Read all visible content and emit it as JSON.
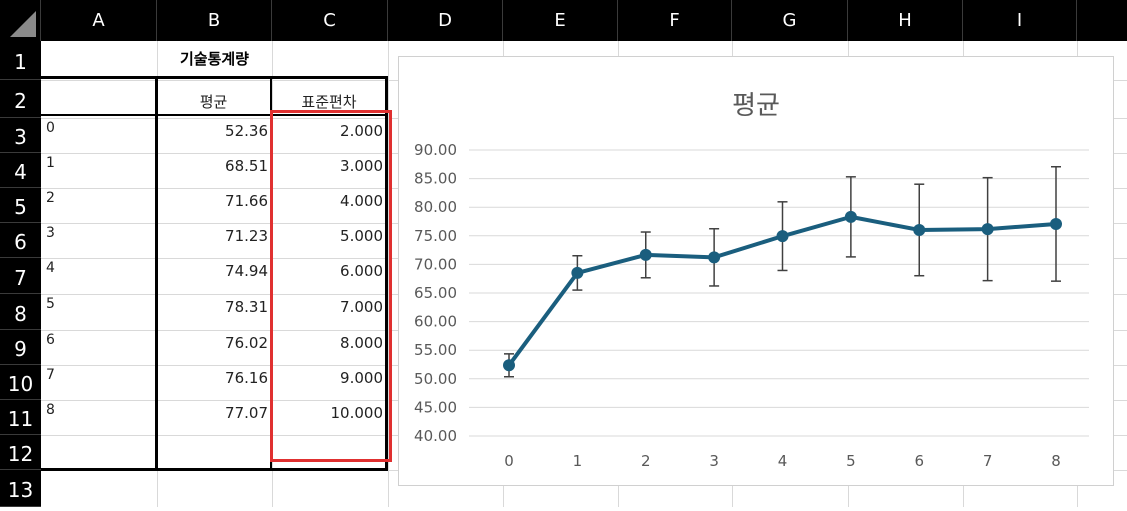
{
  "sheet": {
    "columns": [
      "A",
      "B",
      "C",
      "D",
      "E",
      "F",
      "G",
      "H",
      "I"
    ],
    "rows": [
      "1",
      "2",
      "3",
      "4",
      "5",
      "6",
      "7",
      "8",
      "9",
      "10",
      "11",
      "12",
      "13"
    ]
  },
  "table": {
    "title": "기술통계량",
    "headers": [
      "평균",
      "표준편차"
    ],
    "rows": [
      {
        "index": "0",
        "mean": "52.36",
        "sd": "2.000"
      },
      {
        "index": "1",
        "mean": "68.51",
        "sd": "3.000"
      },
      {
        "index": "2",
        "mean": "71.66",
        "sd": "4.000"
      },
      {
        "index": "3",
        "mean": "71.23",
        "sd": "5.000"
      },
      {
        "index": "4",
        "mean": "74.94",
        "sd": "6.000"
      },
      {
        "index": "5",
        "mean": "78.31",
        "sd": "7.000"
      },
      {
        "index": "6",
        "mean": "76.02",
        "sd": "8.000"
      },
      {
        "index": "7",
        "mean": "76.16",
        "sd": "9.000"
      },
      {
        "index": "8",
        "mean": "77.07",
        "sd": "10.000"
      }
    ]
  },
  "chart_data": {
    "type": "line",
    "title": "평균",
    "x": [
      "0",
      "1",
      "2",
      "3",
      "4",
      "5",
      "6",
      "7",
      "8"
    ],
    "series": [
      {
        "values": [
          52.36,
          68.51,
          71.66,
          71.23,
          74.94,
          78.31,
          76.02,
          76.16,
          77.07
        ],
        "error_bars": [
          2,
          3,
          4,
          5,
          6,
          7,
          8,
          9,
          10
        ]
      }
    ],
    "yticks": [
      "40.00",
      "45.00",
      "50.00",
      "55.00",
      "60.00",
      "65.00",
      "70.00",
      "75.00",
      "80.00",
      "85.00",
      "90.00"
    ],
    "ylim": [
      40,
      90
    ],
    "grid": true,
    "line_color": "#1a5e7e",
    "highlight_color": "#e03030"
  }
}
